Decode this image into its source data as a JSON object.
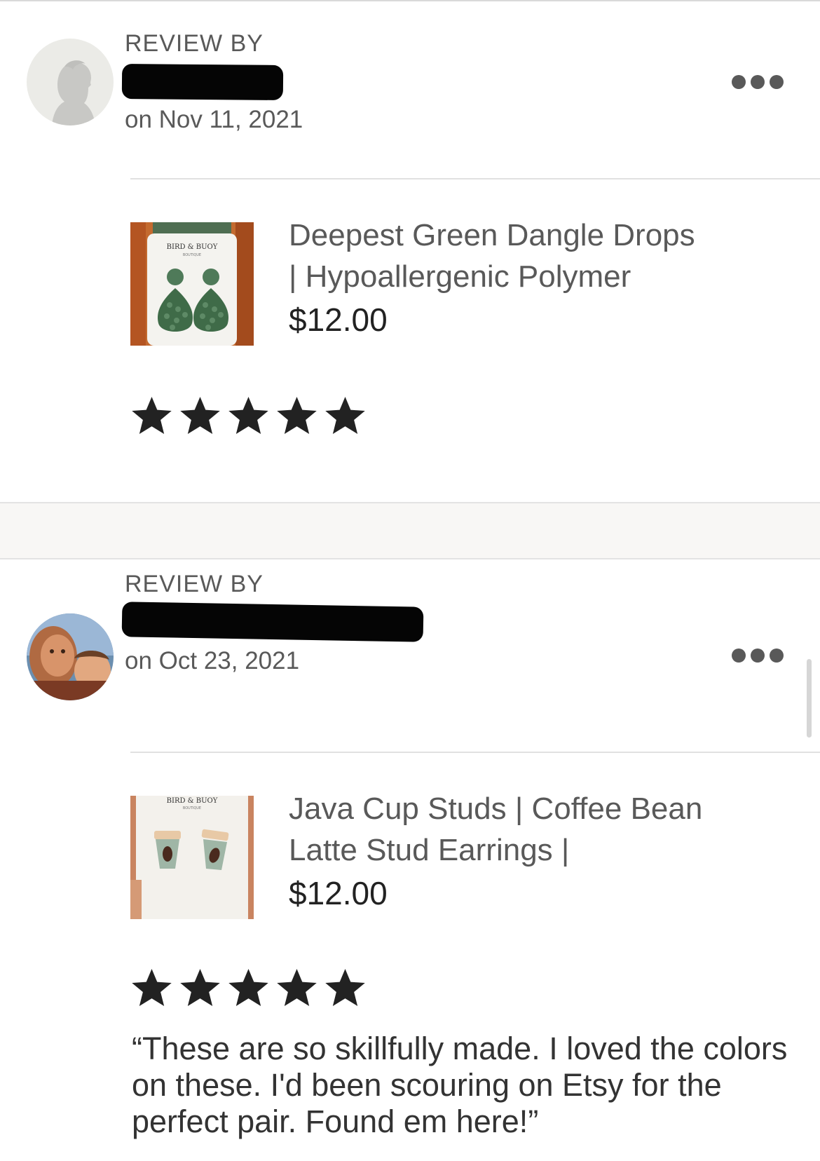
{
  "reviews": [
    {
      "review_by_label": "REVIEW BY",
      "reviewer_name": "[redacted]",
      "date": "on Nov 11, 2021",
      "product": {
        "title_line1": "Deepest Green Dangle Drops",
        "title_line2": "| Hypoallergenic Polymer",
        "price": "$12.00",
        "image_brand": "BIRD & BUOY",
        "image_sub": "BOUTIQUE"
      },
      "rating": 5,
      "text": ""
    },
    {
      "review_by_label": "REVIEW BY",
      "reviewer_name": "[redacted]",
      "date": "on Oct 23, 2021",
      "product": {
        "title_line1": "Java Cup Studs | Coffee Bean",
        "title_line2": "Latte Stud Earrings |",
        "price": "$12.00",
        "image_brand": "BIRD & BUOY",
        "image_sub": "BOUTIQUE"
      },
      "rating": 5,
      "text": "“These are so skillfully made. I loved the colors on these. I'd been scouring on Etsy for the perfect pair. Found em here!”"
    }
  ],
  "icons": {
    "more": "more-options-icon",
    "star": "star-icon",
    "avatar_default": "default-avatar-icon"
  },
  "colors": {
    "star": "#222222",
    "muted_text": "#595959",
    "band": "#f8f7f5"
  }
}
